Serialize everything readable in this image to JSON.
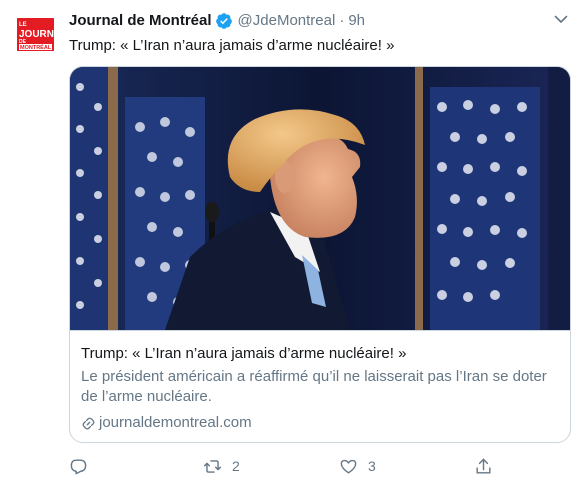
{
  "tweet": {
    "avatar_text": "JOURNAL DE MONTRÉAL",
    "author_name": "Journal de Montréal",
    "handle": "@JdeMontreal",
    "separator": "·",
    "time": "9h",
    "text": "Trump: « L’Iran n’aura jamais d’arme nucléaire! »"
  },
  "card": {
    "title": "Trump: « L’Iran n’aura jamais d’arme nucléaire! »",
    "description": "Le président américain a réaffirmé qu’il ne laisserait pas l’Iran se doter de l’arme nucléaire.",
    "domain": "journaldemontreal.com",
    "image_subject": "photo of speaker in front of american flags"
  },
  "actions": {
    "reply_count": "",
    "retweet_count": "2",
    "like_count": "3"
  },
  "colors": {
    "brand_red": "#e31b23",
    "verified_blue": "#1da1f2",
    "secondary_text": "#657786",
    "border": "#ccd6dd"
  },
  "icons": [
    "verified-badge-icon",
    "chevron-down-icon",
    "link-icon",
    "reply-icon",
    "retweet-icon",
    "like-icon",
    "share-icon"
  ]
}
